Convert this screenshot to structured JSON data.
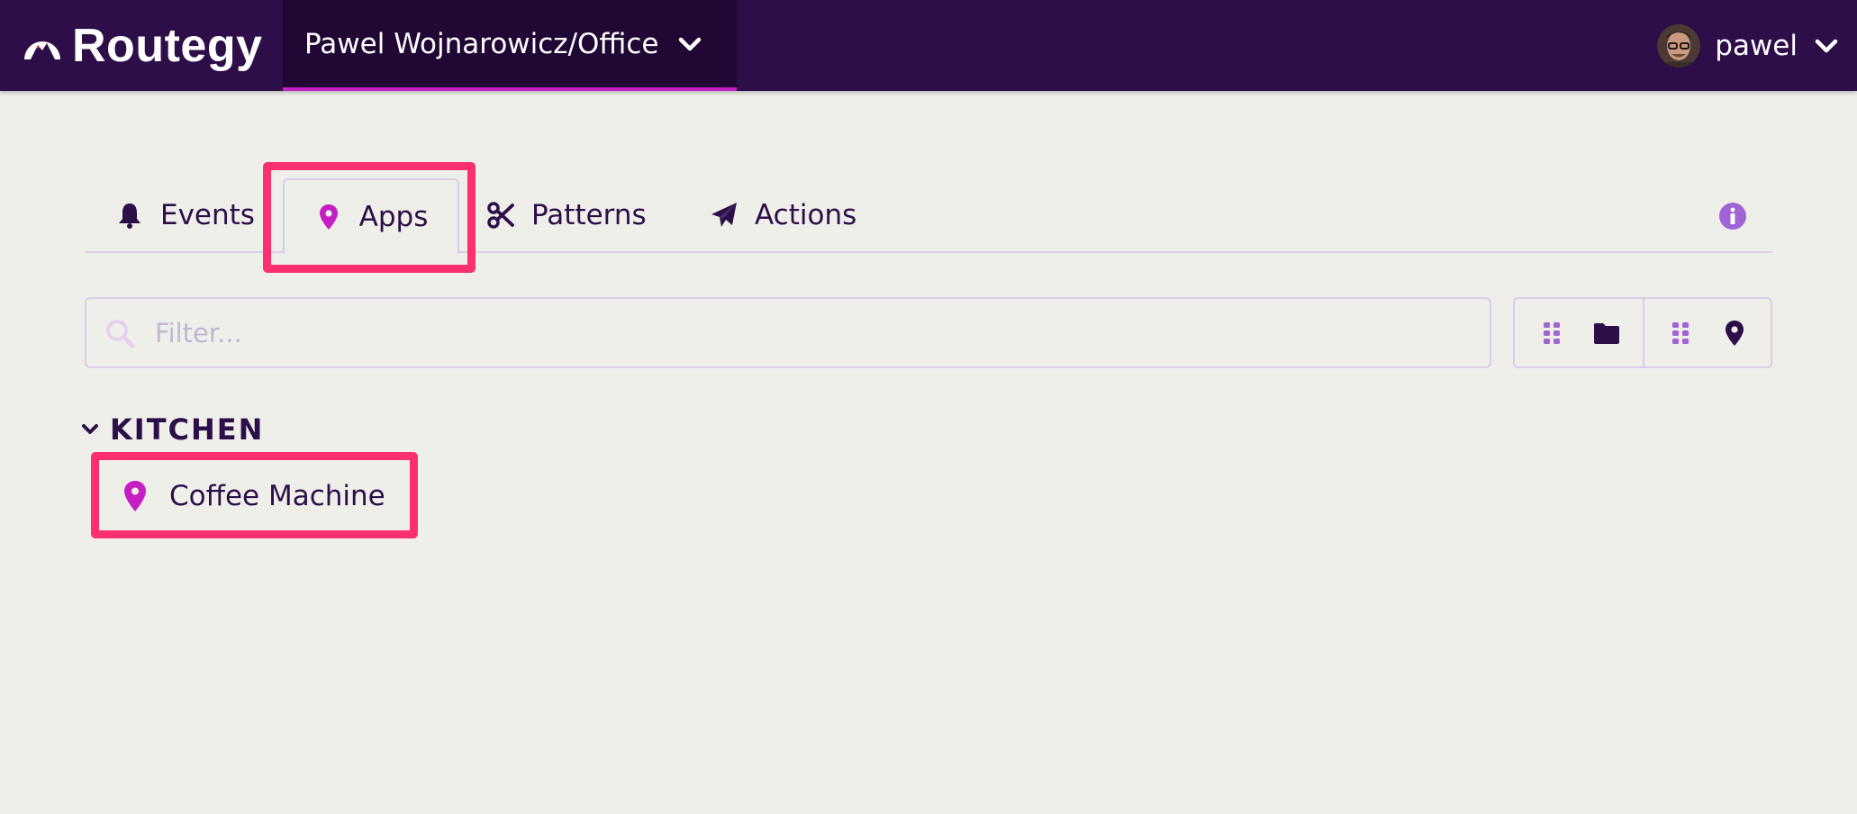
{
  "header": {
    "brand": "Routegy",
    "org_switcher": {
      "label": "Pawel Wojnarowicz/Office",
      "icon": "chevron-down-icon"
    },
    "user": {
      "name": "pawel",
      "avatar": "user-avatar",
      "icon": "chevron-down-icon"
    }
  },
  "tabs": [
    {
      "label": "Events",
      "icon": "bell-icon",
      "active": false
    },
    {
      "label": "Apps",
      "icon": "map-pin-icon",
      "active": true
    },
    {
      "label": "Patterns",
      "icon": "scissors-icon",
      "active": false
    },
    {
      "label": "Actions",
      "icon": "paper-plane-icon",
      "active": false
    }
  ],
  "filter": {
    "placeholder": "Filter...",
    "value": "",
    "icon": "search-icon"
  },
  "view_toggles": [
    {
      "name": "group-by-folder",
      "icons": [
        "grid-icon",
        "folder-icon"
      ]
    },
    {
      "name": "group-by-location",
      "icons": [
        "grid-icon",
        "map-pin-icon"
      ]
    }
  ],
  "groups": [
    {
      "title": "KITCHEN",
      "expanded": true,
      "items": [
        {
          "label": "Coffee Machine",
          "icon": "map-pin-icon"
        }
      ]
    }
  ],
  "colors": {
    "topbar": "#2e0e49",
    "org_switcher_bg": "#200734",
    "accent_magenta": "#c51fc4",
    "highlight": "#fc306d",
    "text_dark": "#2c0f49",
    "icon_lavender": "#a064d6",
    "background": "#efefea",
    "border": "#dacbe9"
  }
}
